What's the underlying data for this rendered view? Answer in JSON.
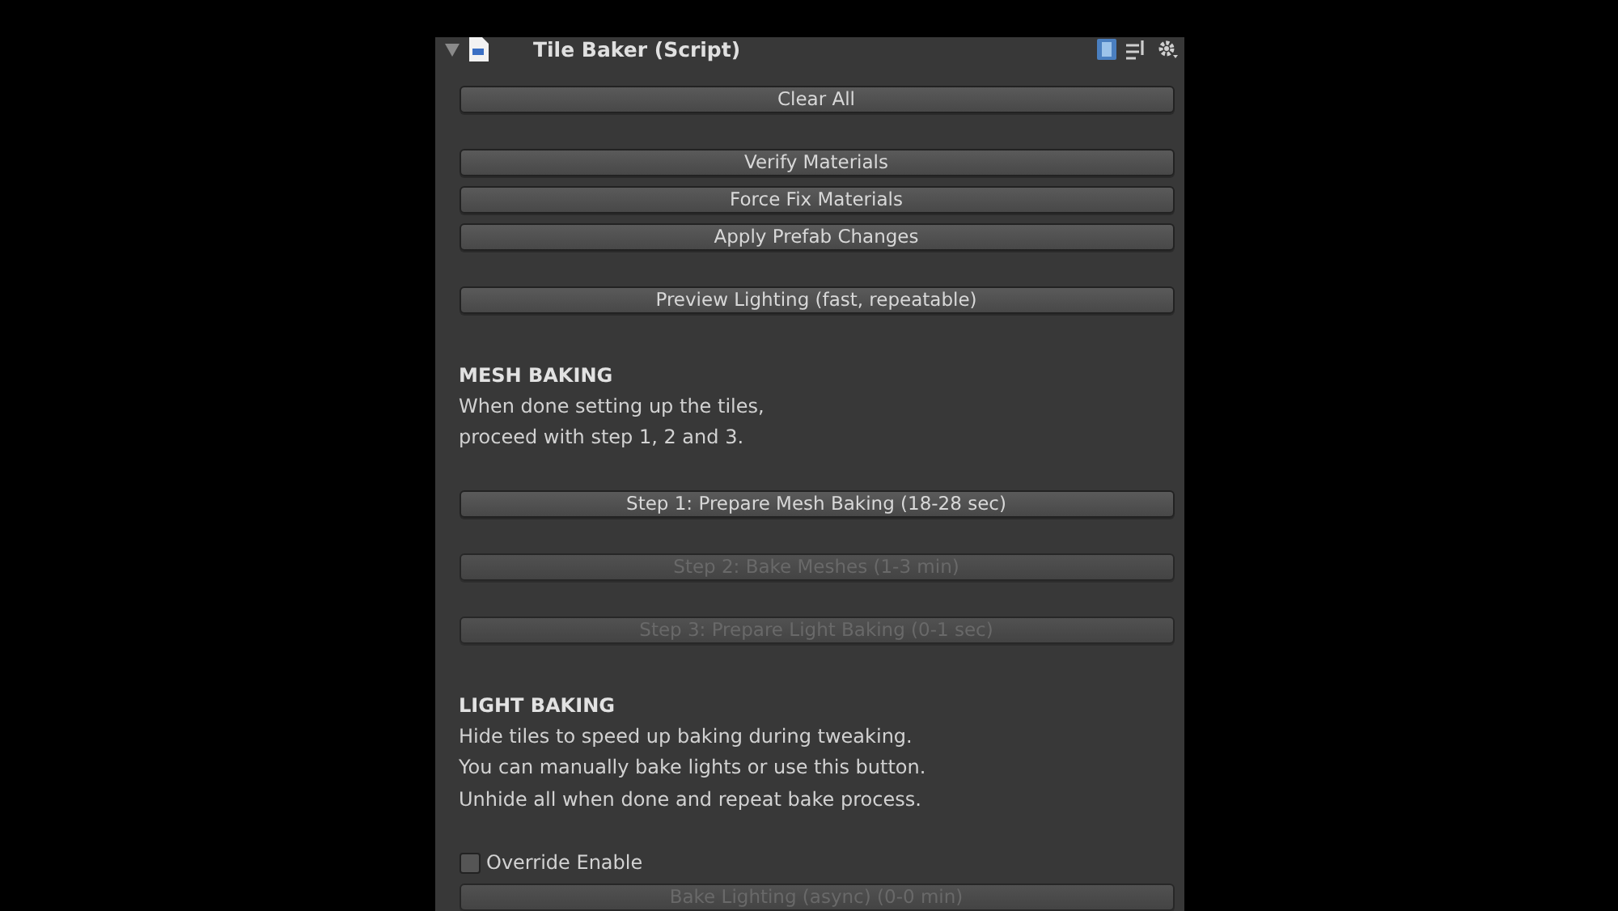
{
  "component": {
    "title": "Tile Baker (Script)",
    "expanded": true
  },
  "groups": [
    [
      {
        "kind": "button",
        "label": "Clear All",
        "disabled": false
      }
    ],
    [
      {
        "kind": "button",
        "label": "Verify Materials",
        "disabled": false
      },
      {
        "kind": "button",
        "label": "Force Fix Materials",
        "disabled": false
      },
      {
        "kind": "button",
        "label": "Apply Prefab Changes",
        "disabled": false
      }
    ],
    [
      {
        "kind": "button",
        "label": "Preview Lighting (fast, repeatable)",
        "disabled": false
      }
    ],
    [
      {
        "kind": "heading",
        "label": "MESH BAKING"
      },
      {
        "kind": "text",
        "label": "When done setting up the tiles,"
      },
      {
        "kind": "text",
        "label": "proceed with step 1, 2 and 3."
      }
    ],
    [
      {
        "kind": "button",
        "label": "Step 1: Prepare Mesh Baking (18-28 sec)",
        "disabled": false
      }
    ],
    [
      {
        "kind": "button",
        "label": "Step 2: Bake Meshes (1-3 min)",
        "disabled": true
      }
    ],
    [
      {
        "kind": "button",
        "label": "Step 3: Prepare Light Baking (0-1 sec)",
        "disabled": true
      }
    ],
    [
      {
        "kind": "heading",
        "label": "LIGHT BAKING"
      },
      {
        "kind": "text",
        "label": "Hide tiles to speed up baking during tweaking."
      },
      {
        "kind": "text",
        "label": "You can manually bake lights or use this button."
      },
      {
        "kind": "text",
        "label": "Unhide all when done and repeat bake process."
      }
    ],
    [
      {
        "kind": "checkbox",
        "label": "Override Enable",
        "checked": false
      },
      {
        "kind": "button",
        "label": "Bake Lighting (async) (0-0 min)",
        "disabled": true
      }
    ]
  ]
}
